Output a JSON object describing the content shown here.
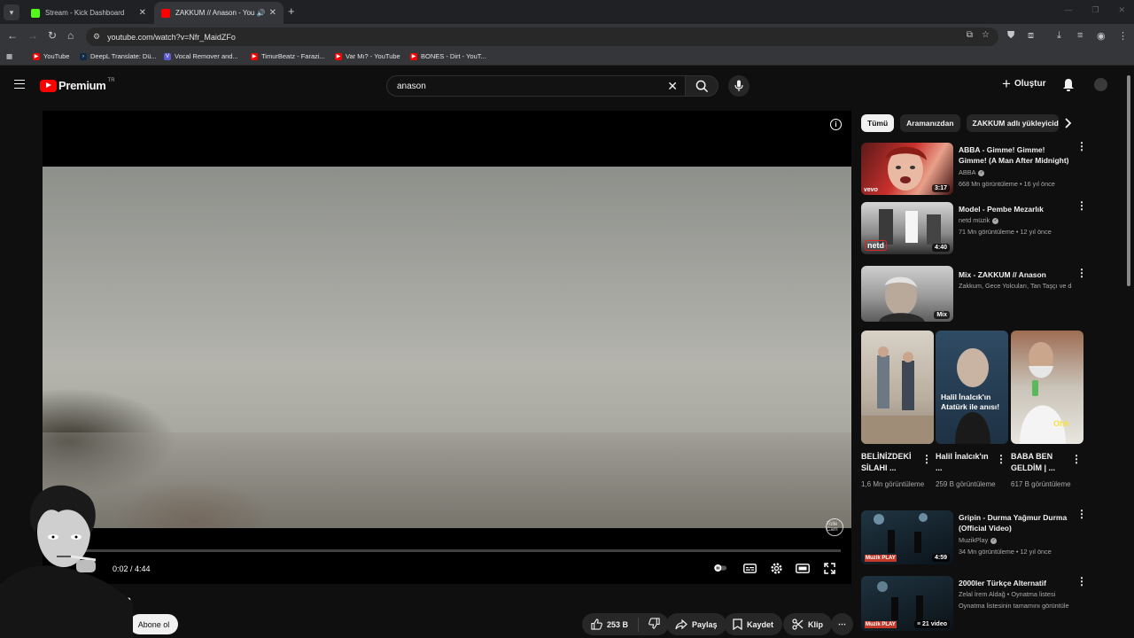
{
  "browser": {
    "tabs": [
      {
        "title": "Stream - Kick Dashboard",
        "active": false,
        "favicon": "kick-icon"
      },
      {
        "title": "ZAKKUM // Anason - YouTube",
        "active": true,
        "favicon": "youtube-icon"
      }
    ],
    "address": "youtube.com/watch?v=Nfr_MaidZFo",
    "bookmarks": [
      {
        "label": "YouTube",
        "icon": "youtube-icon"
      },
      {
        "label": "DeepL Translate: Dü...",
        "icon": "deepl-icon"
      },
      {
        "label": "Vocal Remover and...",
        "icon": "vocal-remover-icon"
      },
      {
        "label": "TimurBeatz - Farazi...",
        "icon": "youtube-icon"
      },
      {
        "label": "Var Mı? - YouTube",
        "icon": "youtube-icon"
      },
      {
        "label": "BONES - Dirt - YouT...",
        "icon": "youtube-icon"
      }
    ]
  },
  "header": {
    "logo_text": "Premium",
    "country": "TR",
    "search_value": "anason",
    "create_label": "Oluştur"
  },
  "player": {
    "time": "0:02 / 4:44",
    "progress": 0.007,
    "watermark": "Tolle Cam"
  },
  "video": {
    "title": "ason",
    "subscribe_label": "Abone ol",
    "likes": "253 B",
    "share_label": "Paylaş",
    "save_label": "Kaydet",
    "clip_label": "Klip"
  },
  "sidebar": {
    "chips": [
      "Tümü",
      "Aramanızdan",
      "ZAKKUM adlı yükleyiciden"
    ],
    "recommendations": [
      {
        "title": "ABBA - Gimme! Gimme! Gimme! (A Man After Midnight)",
        "channel": "ABBA",
        "verified": true,
        "meta": "668 Mn görüntüleme • 16 yıl önce",
        "duration": "3:17",
        "brand": "vevo"
      },
      {
        "title": "Model - Pembe Mezarlık",
        "channel": "netd müzik",
        "verified": true,
        "meta": "71 Mn görüntüleme • 12 yıl önce",
        "duration": "4:40",
        "brand": "netd"
      },
      {
        "title": "Mix - ZAKKUM // Anason",
        "channel": "Zakkum, Gece Yolcuları, Tan Taşçı ve daha fazlası",
        "verified": false,
        "meta": "",
        "duration": "Mix",
        "brand": ""
      }
    ],
    "shorts": [
      {
        "title": "BELİNİZDEKİ SİLAHI ...",
        "views": "1,6 Mn görüntüleme",
        "caption": ""
      },
      {
        "title": "Halil İnalcık'ın ...",
        "views": "259 B görüntüleme",
        "caption": "Halil İnalcık'ın Atatürk ile anısı!"
      },
      {
        "title": "BABA BEN GELDİM | ...",
        "views": "617 B görüntüleme",
        "caption": "Ohh"
      }
    ],
    "recommendations2": [
      {
        "title": "Gripin - Durma Yağmur Durma (Official Video)",
        "channel": "MuzikPlay",
        "verified": true,
        "meta": "34 Mn görüntüleme • 12 yıl önce",
        "duration": "4:59",
        "brand": "Muzik PLAY"
      },
      {
        "title": "2000ler Türkçe Alternatif",
        "channel": "Zelal İrem Aldağ • Oynatma listesi",
        "verified": false,
        "meta": "Oynatma listesinin tamamını görüntüle",
        "duration": "21 video",
        "brand": "Muzik PLAY"
      }
    ]
  },
  "colors": {
    "accent": "#ff0000",
    "background": "#0f0f0f",
    "kick": "#53fc18"
  }
}
